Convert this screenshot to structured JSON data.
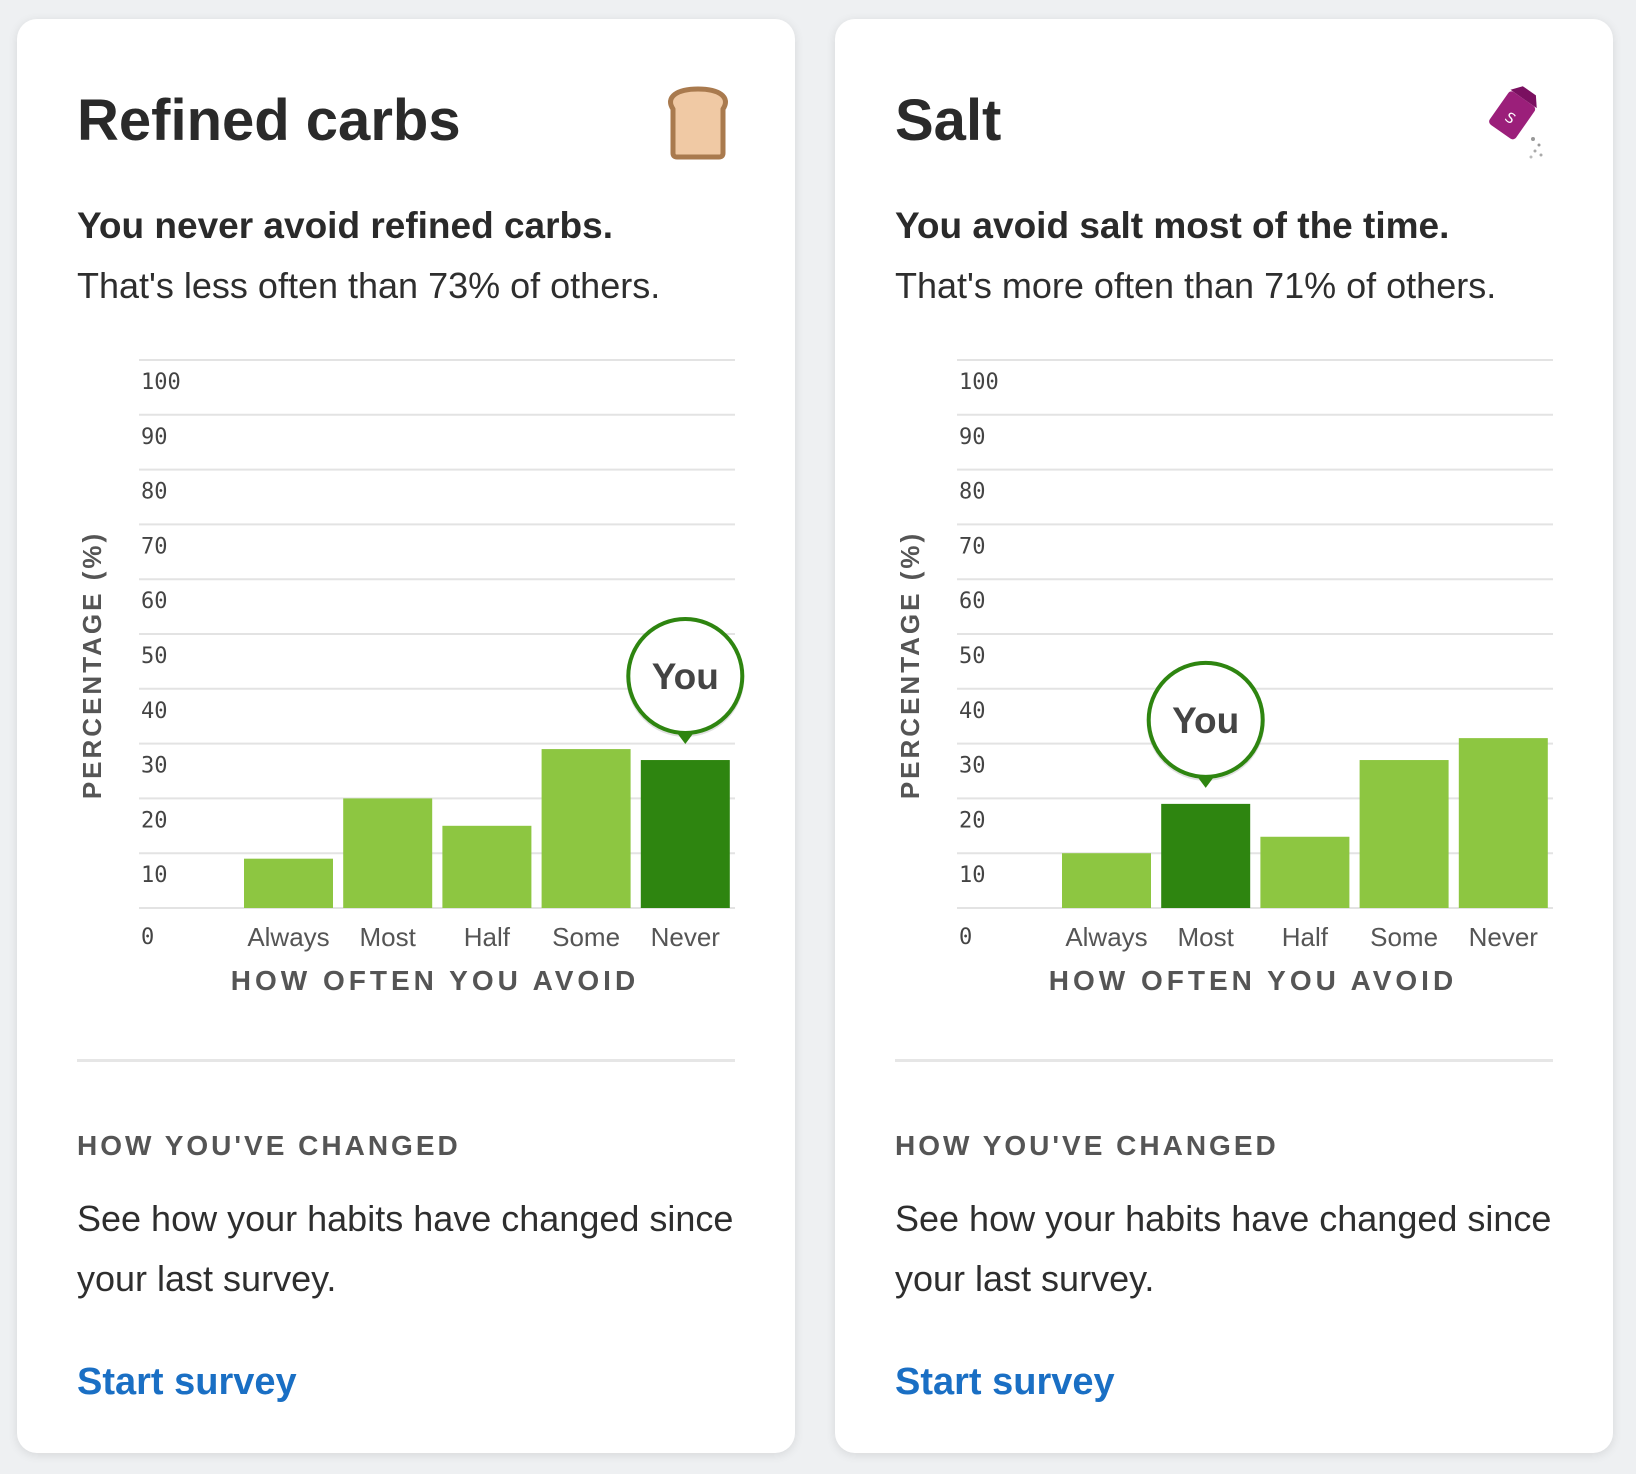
{
  "colors": {
    "bar": "#8dc641",
    "bar_you": "#2e8510",
    "marker_ring": "#2e8510",
    "grid": "#e3e3e3",
    "link": "#1a6fc4"
  },
  "cards": [
    {
      "title": "Refined carbs",
      "icon": "bread-slice-icon",
      "headline": "You never avoid refined carbs.",
      "comparison": "That's less often than 73% of others.",
      "changed_heading": "HOW YOU'VE CHANGED",
      "changed_text": "See how your habits have changed since your last survey.",
      "cta": "Start survey"
    },
    {
      "title": "Salt",
      "icon": "salt-shaker-icon",
      "headline": "You avoid salt most of the time.",
      "comparison": "That's more often than 71% of others.",
      "changed_heading": "HOW YOU'VE CHANGED",
      "changed_text": "See how your habits have changed since your last survey.",
      "cta": "Start survey"
    }
  ],
  "chart_data": [
    {
      "type": "bar",
      "categories": [
        "Always",
        "Most",
        "Half",
        "Some",
        "Never"
      ],
      "values": [
        9,
        20,
        15,
        29,
        27
      ],
      "highlight_index": 4,
      "marker_label": "You",
      "xlabel": "HOW OFTEN YOU AVOID",
      "ylabel": "PERCENTAGE (%)",
      "yticks": [
        0,
        10,
        20,
        30,
        40,
        50,
        60,
        70,
        80,
        90,
        100
      ],
      "ylim": [
        0,
        100
      ],
      "grid": true
    },
    {
      "type": "bar",
      "categories": [
        "Always",
        "Most",
        "Half",
        "Some",
        "Never"
      ],
      "values": [
        10,
        19,
        13,
        27,
        31
      ],
      "highlight_index": 1,
      "marker_label": "You",
      "xlabel": "HOW OFTEN YOU AVOID",
      "ylabel": "PERCENTAGE (%)",
      "yticks": [
        0,
        10,
        20,
        30,
        40,
        50,
        60,
        70,
        80,
        90,
        100
      ],
      "ylim": [
        0,
        100
      ],
      "grid": true
    }
  ]
}
